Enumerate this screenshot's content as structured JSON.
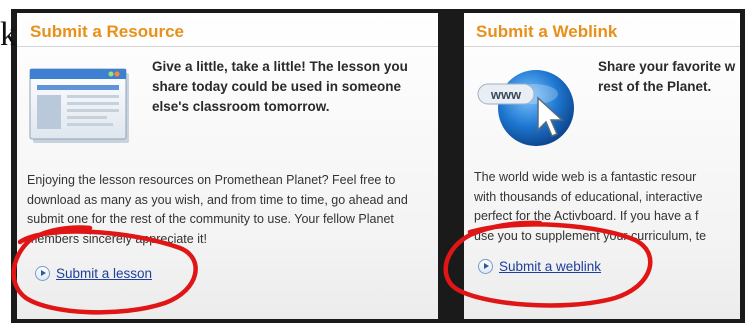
{
  "outside_text": "k'",
  "resource_panel": {
    "title": "Submit a Resource",
    "intro": "Give a little, take a little! The lesson you share today could be used in someone else's classroom tomorrow.",
    "body": "Enjoying the lesson resources on Promethean Planet? Feel free to download as many as you wish, and from time to time, go ahead and submit one for the rest of the community to use. Your fellow Planet members sincerely appreciate it!",
    "link_label": "Submit a lesson",
    "icon": "web-page-document-icon"
  },
  "weblink_panel": {
    "title": "Submit a Weblink",
    "intro_lines": [
      "Share your favorite w",
      "rest of the Planet."
    ],
    "body_lines": [
      "The world wide web is a fantastic resour",
      "with thousands of educational, interactive",
      "perfect for the Activboard. If you have a f",
      "use you to supplement your curriculum, te"
    ],
    "link_label": "Submit a weblink",
    "icon": "www-globe-cursor-icon",
    "icon_text": "www"
  },
  "colors": {
    "title_orange": "#e8901a",
    "link_blue": "#1e3f9c",
    "annotation_red": "#e01515",
    "frame": "#1a1a1a"
  }
}
